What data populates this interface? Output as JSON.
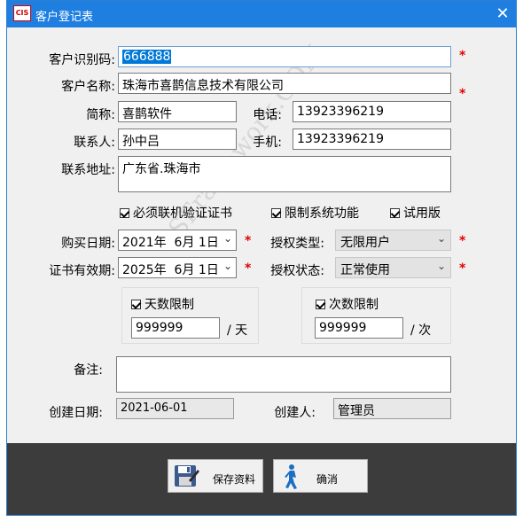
{
  "window": {
    "title": "客户登记表",
    "icon_text": "CIS",
    "close_symbol": "✕"
  },
  "fields": {
    "customer_id": {
      "label": "客户识别码:",
      "value": "666888"
    },
    "customer_name": {
      "label": "客户名称:",
      "value": "珠海市喜鹊信息技术有限公司"
    },
    "short_name": {
      "label": "简称:",
      "value": "喜鹊软件"
    },
    "phone": {
      "label": "电话:",
      "value": "13923396219"
    },
    "contact": {
      "label": "联系人:",
      "value": "孙中吕"
    },
    "mobile": {
      "label": "手机:",
      "value": "13923396219"
    },
    "address": {
      "label": "联系地址:",
      "value": "广东省.珠海市"
    }
  },
  "checkboxes": {
    "online_verify": {
      "label": "必须联机验证证书",
      "checked": true
    },
    "limit_features": {
      "label": "限制系统功能",
      "checked": true
    },
    "trial": {
      "label": "试用版",
      "checked": true
    }
  },
  "dates": {
    "purchase": {
      "label": "购买日期:",
      "year": "2021年",
      "month": "6月",
      "day": "1日"
    },
    "expiry": {
      "label": "证书有效期:",
      "year": "2025年",
      "month": "6月",
      "day": "1日"
    }
  },
  "selects": {
    "license_type": {
      "label": "授权类型:",
      "value": "无限用户"
    },
    "license_status": {
      "label": "授权状态:",
      "value": "正常使用"
    }
  },
  "limits": {
    "days": {
      "label": "天数限制",
      "checked": true,
      "value": "999999",
      "unit": "/ 天"
    },
    "count": {
      "label": "次数限制",
      "checked": true,
      "value": "999999",
      "unit": "/ 次"
    }
  },
  "notes": {
    "label": "备注:",
    "value": ""
  },
  "created": {
    "date_label": "创建日期:",
    "date_value": "2021-06-01",
    "by_label": "创建人:",
    "by_value": "管理员"
  },
  "buttons": {
    "save_label": "保存资料",
    "cancel_label": "确消"
  },
  "watermark": "CSFramework.COM",
  "required_mark": "*",
  "colors": {
    "titlebar": "#1e7fe0",
    "selection": "#0078d7",
    "required": "#e00000",
    "bottom_bar": "#3c3c3c"
  }
}
